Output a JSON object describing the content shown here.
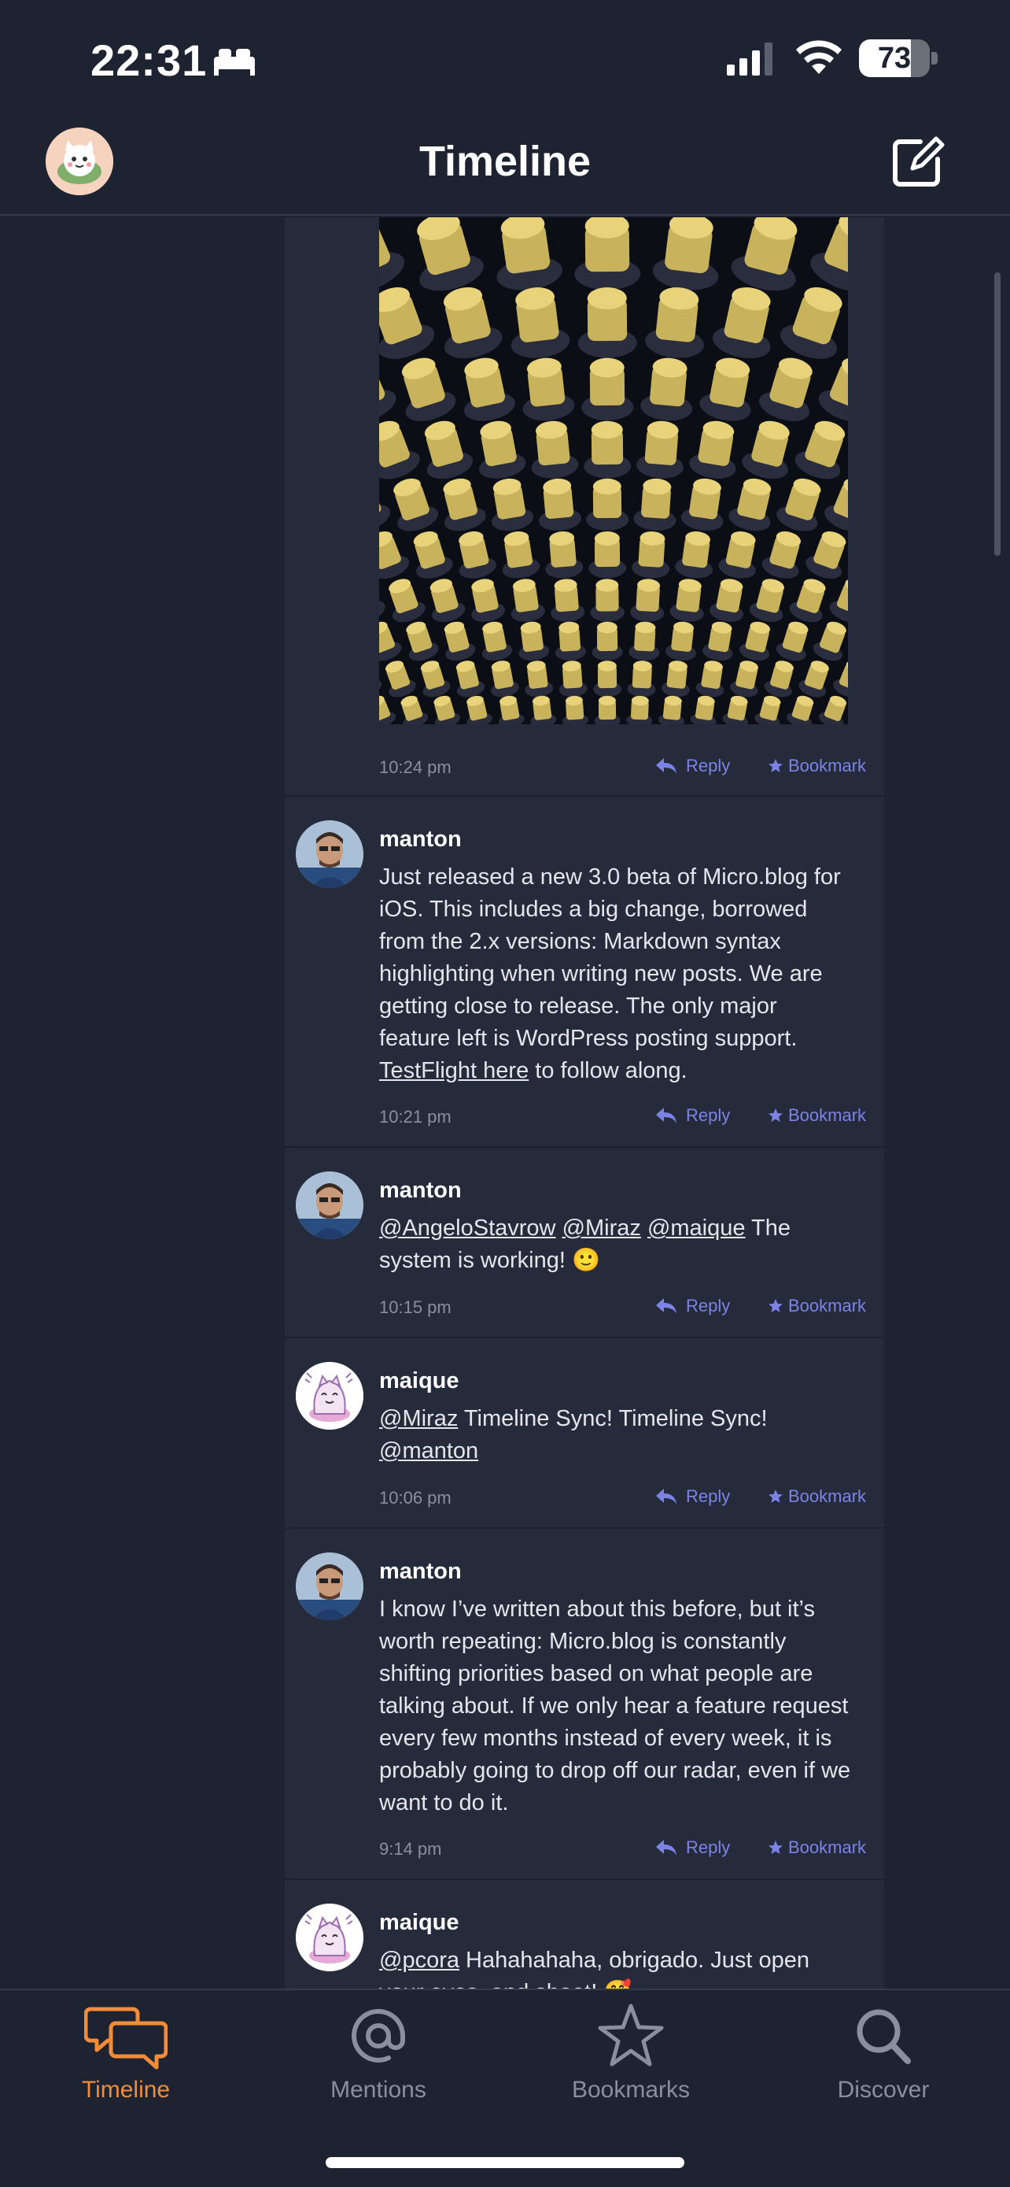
{
  "status_bar": {
    "time": "22:31",
    "battery_percent": 73,
    "battery_label": "73",
    "icons": [
      "bed-icon",
      "cellular-signal-icon",
      "wifi-icon",
      "battery-icon"
    ]
  },
  "header": {
    "title": "Timeline",
    "left_icon": "profile-avatar",
    "right_icon": "compose-icon"
  },
  "actions": {
    "reply_label": "Reply",
    "bookmark_label": "Bookmark"
  },
  "first_post_meta": {
    "time": "10:24 pm",
    "image": "photo of rows of wine bottles with gold foil caps"
  },
  "posts": [
    {
      "author": "manton",
      "text_segments": [
        {
          "text": "Just released a new 3.0 beta of Micro.blog for iOS. This includes a big change, borrowed from the 2.x versions: Markdown syntax highlighting when writing new posts. We are getting close to release. The only major feature left is WordPress posting support. ",
          "link": false
        },
        {
          "text": "TestFlight here",
          "link": true
        },
        {
          "text": " to follow along.",
          "link": false
        }
      ],
      "time": "10:21 pm"
    },
    {
      "author": "manton",
      "text_segments": [
        {
          "text": "@AngeloStavrow",
          "link": true
        },
        {
          "text": " ",
          "link": false
        },
        {
          "text": "@Miraz",
          "link": true
        },
        {
          "text": " ",
          "link": false
        },
        {
          "text": "@maique",
          "link": true
        },
        {
          "text": " The system is working! 🙂",
          "link": false
        }
      ],
      "time": "10:15 pm"
    },
    {
      "author": "maique",
      "text_segments": [
        {
          "text": "@Miraz",
          "link": true
        },
        {
          "text": " Timeline Sync! Timeline Sync! ",
          "link": false
        },
        {
          "text": "@manton",
          "link": true
        }
      ],
      "time": "10:06 pm"
    },
    {
      "author": "manton",
      "text_segments": [
        {
          "text": "I know I’ve written about this before, but it’s worth repeating: Micro.blog is constantly shifting priorities based on what people are talking about. If we only hear a feature request every few months instead of every week, it is probably going to drop off our radar, even if we want to do it.",
          "link": false
        }
      ],
      "time": "9:14 pm"
    },
    {
      "author": "maique",
      "text_segments": [
        {
          "text": "@pcora",
          "link": true
        },
        {
          "text": " Hahahahaha, obrigado. Just open your eyes, and shoot! 🥰",
          "link": false
        }
      ],
      "time": ""
    }
  ],
  "tabbar": {
    "tabs": [
      {
        "label": "Timeline",
        "icon": "speech-bubbles-icon",
        "active": true
      },
      {
        "label": "Mentions",
        "icon": "at-sign-icon",
        "active": false
      },
      {
        "label": "Bookmarks",
        "icon": "star-icon",
        "active": false
      },
      {
        "label": "Discover",
        "icon": "search-icon",
        "active": false
      }
    ]
  },
  "colors": {
    "background": "#1e2331",
    "feed_background": "#262b3b",
    "accent": "#f28c38",
    "link_action": "#7c83e6",
    "muted_text": "#8a8fa0"
  }
}
